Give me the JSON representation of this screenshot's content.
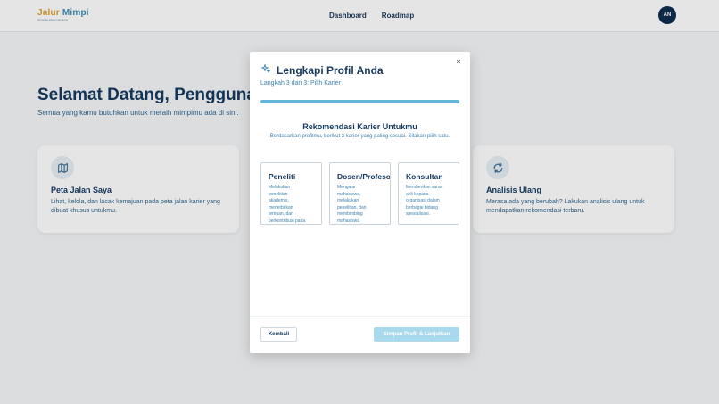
{
  "header": {
    "logo_first": "Jalur",
    "logo_second": " Mimpi",
    "logo_tagline": "Temukan karier impianmu",
    "nav": [
      "Dashboard",
      "Roadmap"
    ],
    "avatar_initials": "AN"
  },
  "main": {
    "welcome_title": "Selamat Datang, Pengguna Baru!",
    "welcome_sub": "Semua yang kamu butuhkan untuk meraih mimpimu ada di sini.",
    "cards": [
      {
        "title": "Peta Jalan Saya",
        "desc": "Lihat, kelola, dan lacak kemajuan pada peta jalan karier yang dibuat khusus untukmu.",
        "icon": "map-icon"
      },
      {
        "title": "Analisis Ulang",
        "desc": "Merasa ada yang berubah? Lakukan analisis ulang untuk mendapatkan rekomendasi terbaru.",
        "icon": "refresh-icon"
      }
    ]
  },
  "modal": {
    "title": "Lengkapi Profil Anda",
    "icon": "sparkle-icon",
    "step": "Langkah 3 dari 3: Pilih Karier",
    "progress": 1.0,
    "rec_title": "Rekomendasi Karier Untukmu",
    "rec_sub": "Berdasarkan profilmu, berikut 3 karier yang paling sesuai. Silakan pilih satu.",
    "options": [
      {
        "title": "Peneliti",
        "desc": "Melakukan penelitian akademis, menerbitkan temuan, dan berkontribusi pada pemahaman bidang studi."
      },
      {
        "title": "Dosen/Profesor",
        "desc": "Mengajar mahasiswa, melakukan penelitian, dan membimbing mahasiswa pascasarjana."
      },
      {
        "title": "Konsultan",
        "desc": "Memberikan saran ahli kepada organisasi dalam berbagai bidang spesialisasi."
      }
    ],
    "back_label": "Kembali",
    "save_label": "Simpan Profil & Lanjutkan",
    "close_symbol": "×"
  },
  "colors": {
    "primary": "#173a60",
    "accent": "#3b82b0",
    "progress": "#64b5d6",
    "disabled_button": "#a9d9ec",
    "avatar": "#0f2d4f"
  }
}
